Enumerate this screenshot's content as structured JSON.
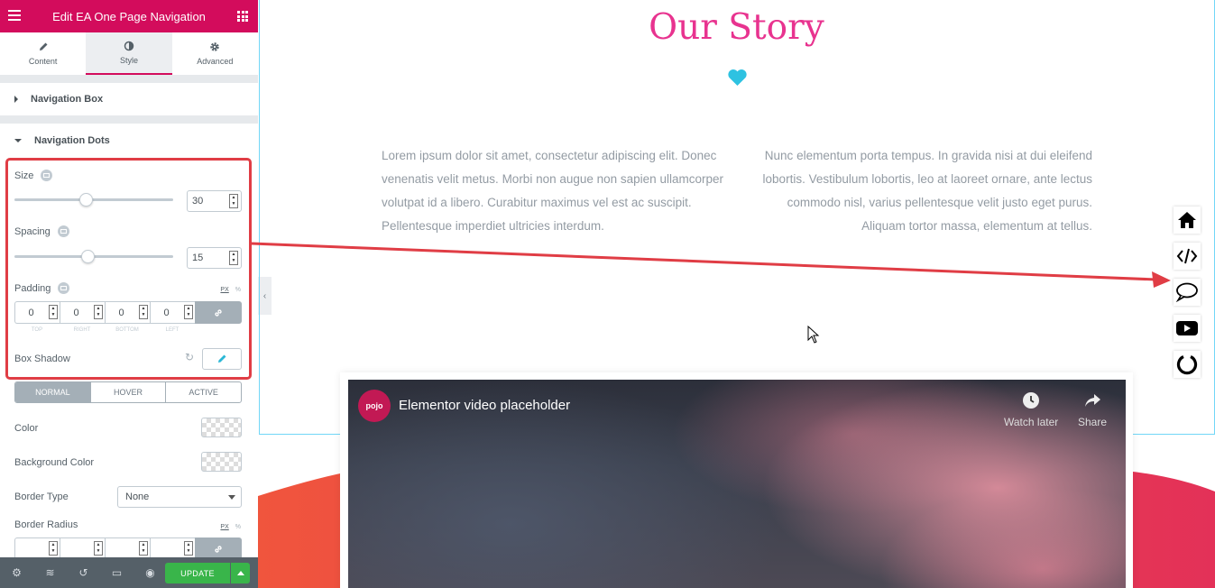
{
  "panel": {
    "title": "Edit EA One Page Navigation",
    "tabs": [
      {
        "label": "Content",
        "icon": "pencil-icon"
      },
      {
        "label": "Style",
        "icon": "contrast-icon"
      },
      {
        "label": "Advanced",
        "icon": "gear-icon"
      }
    ],
    "sections": {
      "nav_box": "Navigation Box",
      "nav_dots": "Navigation Dots"
    },
    "size": {
      "label": "Size",
      "value": "30",
      "slider_fraction": 0.45
    },
    "spacing": {
      "label": "Spacing",
      "value": "15",
      "slider_fraction": 0.46
    },
    "padding": {
      "label": "Padding",
      "unit_px": "PX",
      "unit_pct": "%",
      "values": [
        "0",
        "0",
        "0",
        "0"
      ],
      "labels": [
        "TOP",
        "RIGHT",
        "BOTTOM",
        "LEFT"
      ]
    },
    "box_shadow": {
      "label": "Box Shadow"
    },
    "state_tabs": [
      "NORMAL",
      "HOVER",
      "ACTIVE"
    ],
    "color": {
      "label": "Color"
    },
    "bg_color": {
      "label": "Background Color"
    },
    "border_type": {
      "label": "Border Type",
      "value": "None"
    },
    "border_radius": {
      "label": "Border Radius",
      "unit_px": "PX",
      "unit_pct": "%"
    },
    "footer": {
      "update": "UPDATE"
    }
  },
  "preview": {
    "title": "Our Story",
    "para_left": "Lorem ipsum dolor sit amet, consectetur adipiscing elit. Donec venenatis velit metus. Morbi non augue non sapien ullamcorper volutpat id a libero. Curabitur maximus vel est ac suscipit. Pellentesque imperdiet ultricies interdum.",
    "para_right": "Nunc elementum porta tempus. In gravida nisi at dui eleifend lobortis. Vestibulum lobortis, leo at laoreet ornare, ante lectus commodo nisl, varius pellentesque velit justo eget purus. Aliquam tortor massa, elementum at tellus.",
    "video": {
      "logo": "pojo",
      "title": "Elementor video placeholder",
      "watch_later": "Watch later",
      "share": "Share"
    },
    "side_nav_icons": [
      "home-icon",
      "code-icon",
      "comment-icon",
      "youtube-icon",
      "circle-notch-icon"
    ]
  },
  "colors": {
    "brand": "#d30c5c",
    "title": "#e8338f",
    "heart": "#2ec2e1",
    "update": "#39b54a",
    "annotation": "#e03d45"
  }
}
